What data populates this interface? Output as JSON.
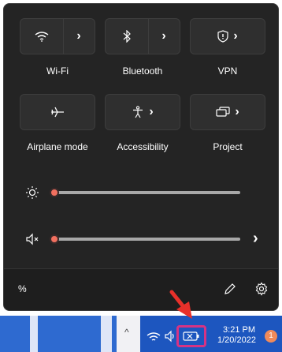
{
  "tiles": [
    {
      "label": "Wi-Fi",
      "icon": "wifi-icon",
      "has_expand": true
    },
    {
      "label": "Bluetooth",
      "icon": "bluetooth-icon",
      "has_expand": true
    },
    {
      "label": "VPN",
      "icon": "shield-icon",
      "has_expand": true
    },
    {
      "label": "Airplane mode",
      "icon": "airplane-icon",
      "has_expand": false
    },
    {
      "label": "Accessibility",
      "icon": "accessibility-icon",
      "has_expand": true
    },
    {
      "label": "Project",
      "icon": "project-icon",
      "has_expand": true
    }
  ],
  "sliders": {
    "brightness": {
      "icon": "brightness-icon",
      "level_percent": 0
    },
    "volume": {
      "icon": "volume-mute-icon",
      "level_percent": 0,
      "chevron": "›"
    }
  },
  "footer": {
    "battery_text": "%",
    "edit_icon": "pencil-icon",
    "settings_icon": "gear-icon"
  },
  "taskbar": {
    "chevron": "^",
    "time": "3:21 PM",
    "date": "1/20/2022",
    "notification_count": "1"
  },
  "annotation": {
    "arrow_color": "#e8302a",
    "highlight_color": "#d63384"
  },
  "colors": {
    "panel_bg": "#242424",
    "tile_bg": "#2f2f2f",
    "accent": "#f2705f",
    "taskbar_blue": "#2a66c8"
  }
}
